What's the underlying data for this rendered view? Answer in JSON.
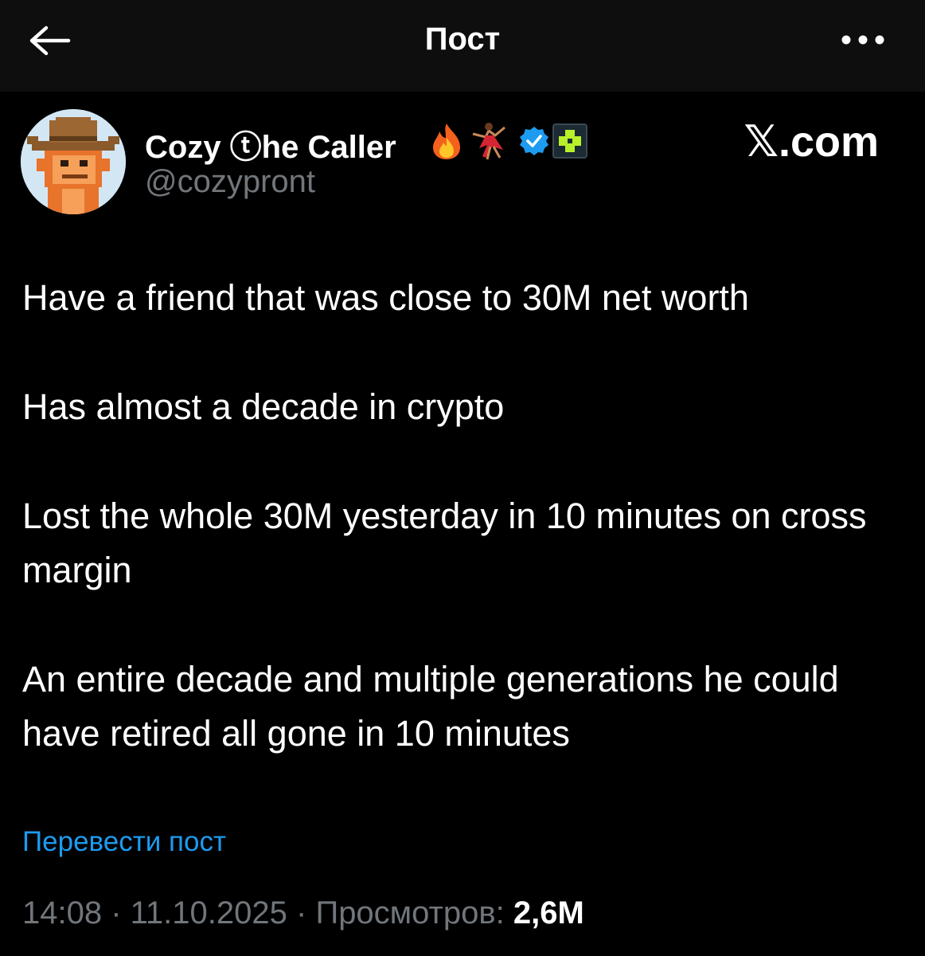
{
  "header": {
    "title": "Пост",
    "back_icon": "arrow-left-icon",
    "more_icon": "more-horizontal-icon"
  },
  "author": {
    "name": "Cozy ⓣhe Caller",
    "handle": "@cozypront",
    "avatar_icon": "pixel-monkey-cowboy-avatar",
    "badges": [
      "fire-emoji",
      "dancer-emoji",
      "verified-badge",
      "affiliate-badge"
    ]
  },
  "watermark": "𝕏.com",
  "tweet": {
    "paragraphs": [
      "Have a friend that was close to 30M net worth",
      "Has almost a decade in crypto",
      "Lost the whole 30M yesterday in 10 minutes on cross margin",
      "An entire decade and multiple generations he could have retired all gone in 10 minutes"
    ]
  },
  "translate_label": "Перевести пост",
  "meta": {
    "time": "14:08",
    "separator": " · ",
    "date": "11.10.2025",
    "views_label": "Просмотров: ",
    "views_count": "2,6M"
  },
  "colors": {
    "background": "#000000",
    "header_bg": "#0e0e0e",
    "text": "#ffffff",
    "muted": "#71767b",
    "accent": "#1d9bf0"
  }
}
